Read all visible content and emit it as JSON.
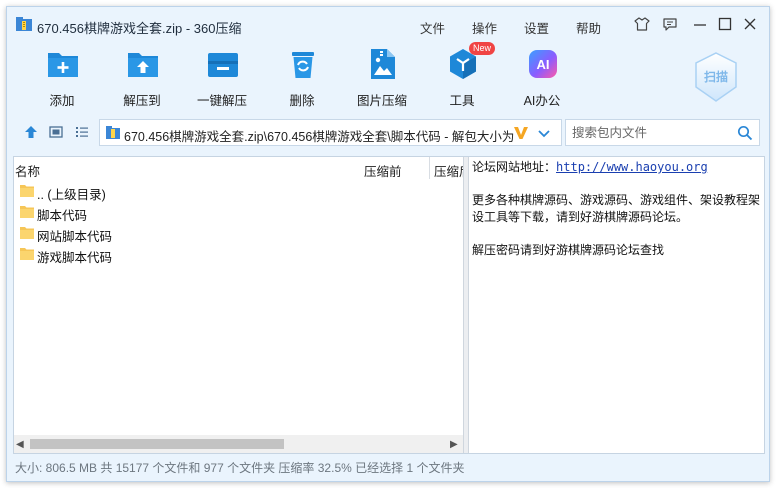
{
  "window": {
    "title": "670.456棋牌游戏全套.zip - 360压缩"
  },
  "menu": {
    "items": [
      "文件",
      "操作",
      "设置",
      "帮助"
    ]
  },
  "toolbar": {
    "add": "添加",
    "extract_to": "解压到",
    "one_click_extract": "一键解压",
    "delete": "删除",
    "image_compress": "图片压缩",
    "tools": "工具",
    "tools_badge": "New",
    "ai_office": "AI办公",
    "ai_icon_text": "AI",
    "scan": "扫描"
  },
  "address": {
    "path": "670.456棋牌游戏全套.zip\\670.456棋牌游戏全套\\脚本代码 - 解包大小为",
    "badge": "V"
  },
  "search": {
    "placeholder": "搜索包内文件"
  },
  "file_list": {
    "columns": [
      "名称",
      "压缩前",
      "压缩后"
    ],
    "rows": [
      {
        "name": ".. (上级目录)"
      },
      {
        "name": "脚本代码"
      },
      {
        "name": "网站脚本代码"
      },
      {
        "name": "游戏脚本代码"
      }
    ]
  },
  "notes": {
    "forum_label": "论坛网站地址：",
    "forum_url": "http://www.haoyou.org",
    "line2": "更多各种棋牌源码、游戏源码、游戏组件、架设教程架设工具等下载，请到好游棋牌源码论坛。",
    "line3": "解压密码请到好游棋牌源码论坛查找"
  },
  "status": {
    "text": "大小: 806.5 MB 共 15177 个文件和 977 个文件夹 压缩率 32.5% 已经选择 1 个文件夹"
  },
  "colors": {
    "accent": "#1e88d8",
    "window_bg": "#eaf4fd",
    "folder": "#f6c657",
    "badge_red": "#f04444"
  }
}
